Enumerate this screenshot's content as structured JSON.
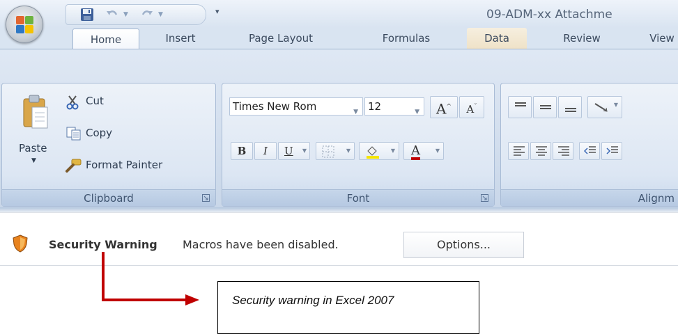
{
  "window": {
    "title": "09-ADM-xx Attachme"
  },
  "tabs": [
    "Home",
    "Insert",
    "Page Layout",
    "Formulas",
    "Data",
    "Review",
    "View"
  ],
  "clipboard": {
    "paste_label": "Paste",
    "cut_label": "Cut",
    "copy_label": "Copy",
    "format_painter_label": "Format Painter",
    "group_label": "Clipboard"
  },
  "font": {
    "font_name": "Times New Rom",
    "font_size": "12",
    "bold": "B",
    "italic": "I",
    "underline": "U",
    "grow_label": "A",
    "shrink_label": "A",
    "font_color_label": "A",
    "group_label": "Font"
  },
  "alignment": {
    "group_label": "Alignm"
  },
  "security_bar": {
    "title": "Security Warning",
    "message": "Macros have been disabled.",
    "options_label": "Options..."
  },
  "annotation": {
    "text": "Security warning in Excel 2007"
  },
  "colors": {
    "ribbon_blue": "#c9d7e9",
    "arrow_red": "#c00000",
    "shield_orange": "#e8831e"
  }
}
